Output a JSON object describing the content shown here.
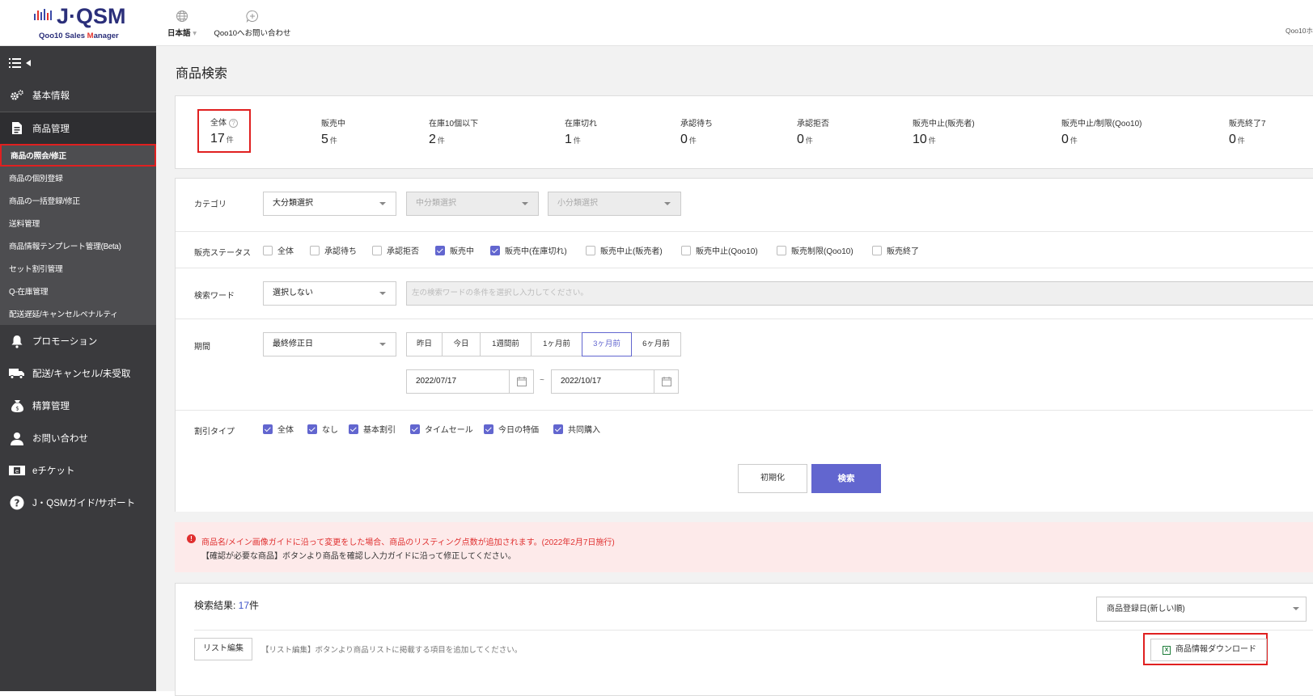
{
  "header": {
    "logo_name": "J·QSM",
    "logo_sub_pre": "Qoo10 Sales ",
    "logo_sub_em": "M",
    "logo_sub_post": "anager",
    "language": "日本語",
    "contact": "Qoo10へお問い合わせ",
    "user": "Qoo10ホ"
  },
  "sidebar": {
    "sections": [
      {
        "label": "基本情報",
        "icon": "gear-icon"
      },
      {
        "label": "商品管理",
        "icon": "document-icon"
      },
      {
        "label": "プロモーション",
        "icon": "bell-icon"
      },
      {
        "label": "配送/キャンセル/未受取",
        "icon": "truck-icon"
      },
      {
        "label": "精算管理",
        "icon": "money-bag-icon"
      },
      {
        "label": "お問い合わせ",
        "icon": "person-icon"
      },
      {
        "label": "eチケット",
        "icon": "ticket-icon"
      },
      {
        "label": "J・QSMガイド/サポート",
        "icon": "question-icon"
      }
    ],
    "sub_items": [
      "商品の照会/修正",
      "商品の個別登録",
      "商品の一括登録/修正",
      "送料管理",
      "商品情報テンプレート管理(Beta)",
      "セット割引管理",
      "Q-在庫管理",
      "配送遅延/キャンセルペナルティ"
    ]
  },
  "page_title": "商品検索",
  "stats": [
    {
      "label": "全体",
      "value": "17",
      "unit": "件"
    },
    {
      "label": "販売中",
      "value": "5",
      "unit": "件"
    },
    {
      "label": "在庫10個以下",
      "value": "2",
      "unit": "件"
    },
    {
      "label": "在庫切れ",
      "value": "1",
      "unit": "件"
    },
    {
      "label": "承認待ち",
      "value": "0",
      "unit": "件"
    },
    {
      "label": "承認拒否",
      "value": "0",
      "unit": "件"
    },
    {
      "label": "販売中止(販売者)",
      "value": "10",
      "unit": "件"
    },
    {
      "label": "販売中止/制限(Qoo10)",
      "value": "0",
      "unit": "件"
    },
    {
      "label": "販売終了7",
      "value": "0",
      "unit": "件"
    }
  ],
  "filters": {
    "category_label": "カテゴリ",
    "category_major": "大分類選択",
    "category_mid": "中分類選択",
    "category_minor": "小分類選択",
    "status_label": "販売ステータス",
    "status_options": [
      {
        "label": "全体",
        "checked": false
      },
      {
        "label": "承認待ち",
        "checked": false
      },
      {
        "label": "承認拒否",
        "checked": false
      },
      {
        "label": "販売中",
        "checked": true
      },
      {
        "label": "販売中(在庫切れ)",
        "checked": true
      },
      {
        "label": "販売中止(販売者)",
        "checked": false
      },
      {
        "label": "販売中止(Qoo10)",
        "checked": false
      },
      {
        "label": "販売制限(Qoo10)",
        "checked": false
      },
      {
        "label": "販売終了",
        "checked": false
      }
    ],
    "keyword_label": "検索ワード",
    "keyword_select": "選択しない",
    "keyword_placeholder": "左の検索ワードの条件を選択し入力してください。",
    "period_label": "期間",
    "period_select": "最終修正日",
    "period_buttons": [
      "昨日",
      "今日",
      "1週間前",
      "1ヶ月前",
      "3ヶ月前",
      "6ヶ月前"
    ],
    "period_selected": "3ヶ月前",
    "date_from": "2022/07/17",
    "date_to": "2022/10/17",
    "tilde": "~",
    "discount_label": "割引タイプ",
    "discount_options": [
      {
        "label": "全体",
        "checked": true
      },
      {
        "label": "なし",
        "checked": true
      },
      {
        "label": "基本割引",
        "checked": true
      },
      {
        "label": "タイムセール",
        "checked": true
      },
      {
        "label": "今日の特価",
        "checked": true
      },
      {
        "label": "共同購入",
        "checked": true
      }
    ],
    "reset_label": "初期化",
    "search_label": "検索"
  },
  "notice": {
    "line1": "商品名/メイン画像ガイドに沿って変更をした場合、商品のリスティング点数が追加されます。(2022年2月7日施行)",
    "line2": "【確認が必要な商品】ボタンより商品を確認し入力ガイドに沿って修正してください。"
  },
  "results": {
    "title_prefix": "検索結果: ",
    "count": "17",
    "unit": "件",
    "sort": "商品登録日(新しい順)",
    "list_edit": "リスト編集",
    "list_hint": "【リスト編集】ボタンより商品リストに掲載する項目を追加してください。",
    "download": "商品情報ダウンロード"
  },
  "colors": {
    "accent": "#6266cf",
    "highlight_border": "#e02020",
    "sidebar_bg": "#3a3a3d",
    "count_blue": "#3e54c8"
  }
}
